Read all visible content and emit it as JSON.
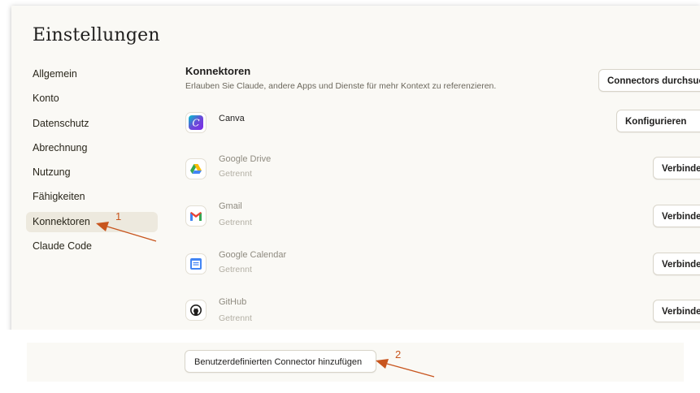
{
  "page_title": "Einstellungen",
  "sidebar": {
    "items": [
      {
        "label": "Allgemein"
      },
      {
        "label": "Konto"
      },
      {
        "label": "Datenschutz"
      },
      {
        "label": "Abrechnung"
      },
      {
        "label": "Nutzung"
      },
      {
        "label": "Fähigkeiten"
      },
      {
        "label": "Konnektoren",
        "active": true
      },
      {
        "label": "Claude Code"
      }
    ]
  },
  "section": {
    "title": "Konnektoren",
    "description": "Erlauben Sie Claude, andere Apps und Dienste für mehr Kontext zu referenzieren.",
    "browse_button": "Connectors durchsuchen"
  },
  "connectors": [
    {
      "name": "Canva",
      "status": "",
      "action": "Konfigurieren",
      "icon": "canva-icon"
    },
    {
      "name": "Google Drive",
      "status": "Getrennt",
      "action": "Verbinden",
      "icon": "google-drive-icon"
    },
    {
      "name": "Gmail",
      "status": "Getrennt",
      "action": "Verbinden",
      "icon": "gmail-icon"
    },
    {
      "name": "Google Calendar",
      "status": "Getrennt",
      "action": "Verbinden",
      "icon": "google-calendar-icon"
    },
    {
      "name": "GitHub",
      "status": "Getrennt",
      "action": "Verbinden",
      "icon": "github-icon"
    }
  ],
  "footer": {
    "add_button": "Benutzerdefinierten Connector hinzufügen"
  },
  "annotations": [
    {
      "label": "1"
    },
    {
      "label": "2"
    }
  ],
  "colors": {
    "background": "#faf9f5",
    "active_item": "#ede9de",
    "annotation": "#c8551e"
  }
}
